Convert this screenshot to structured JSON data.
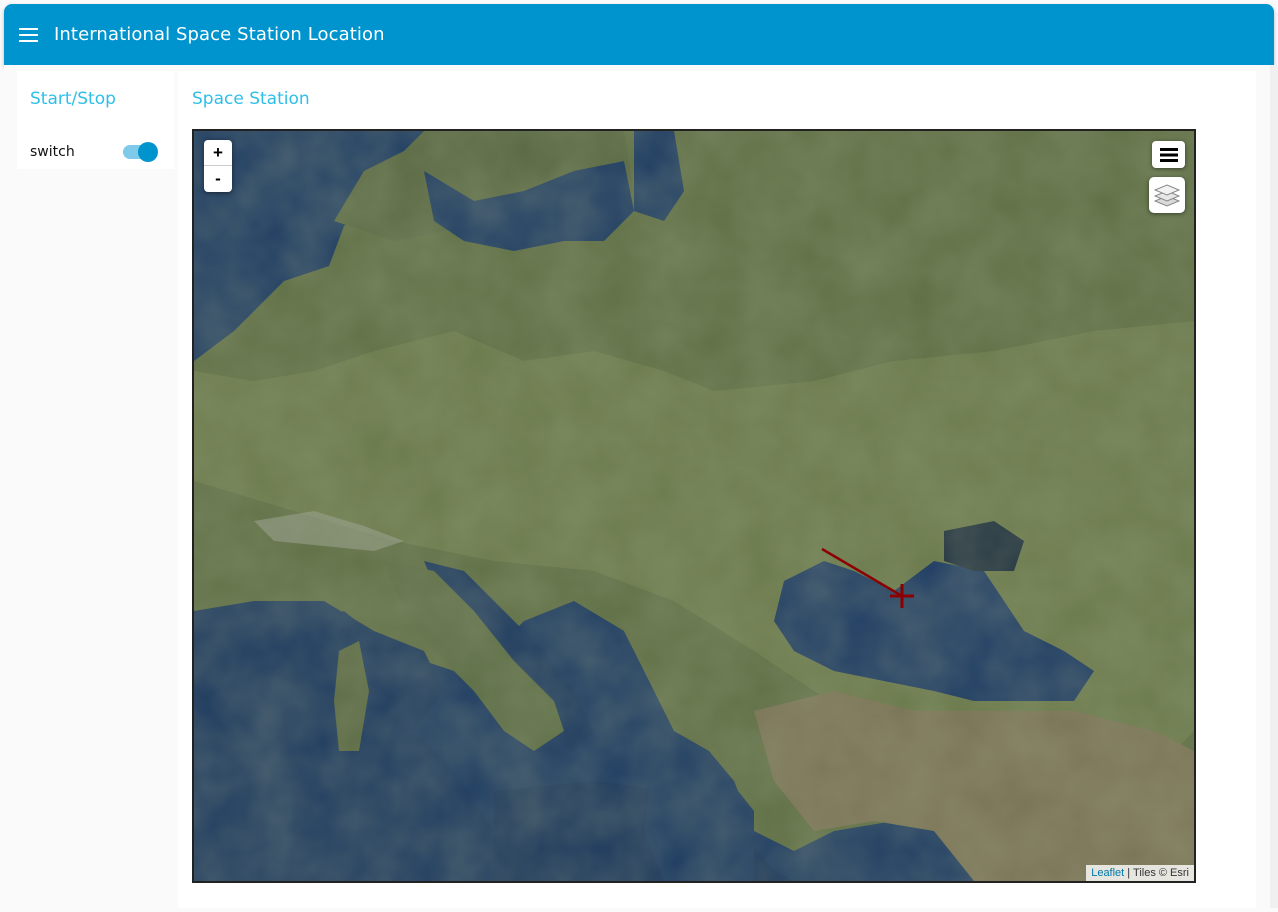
{
  "app": {
    "title": "International Space Station Location"
  },
  "header": {
    "menu_icon": "hamburger-menu-icon"
  },
  "left_group": {
    "title": "Start/Stop",
    "switch": {
      "label": "switch",
      "state": "on",
      "accent": "#0094ce"
    }
  },
  "main_group": {
    "title": "Space Station",
    "map": {
      "zoom_in": "+",
      "zoom_out": "-",
      "attribution_link": "Leaflet",
      "attribution_text": "| Tiles © Esri",
      "track_color": "#8b0000"
    }
  },
  "colors": {
    "brand": "#0094ce",
    "title_accent": "#2ebfe8"
  }
}
